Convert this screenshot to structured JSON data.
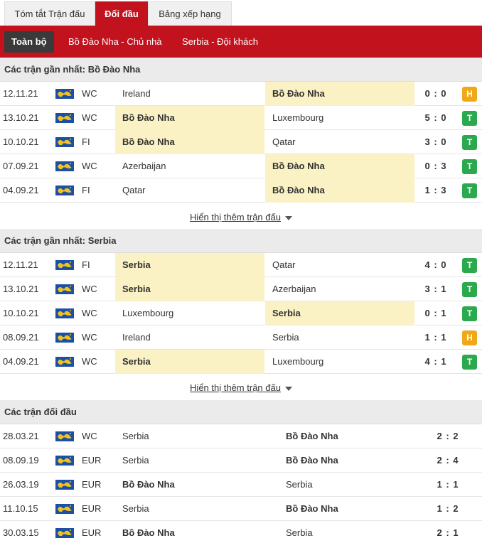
{
  "top_tabs": [
    "Tóm tắt Trận đấu",
    "Đối đầu",
    "Bảng xếp hạng"
  ],
  "sub_tabs": [
    "Toàn bộ",
    "Bồ Đào Nha - Chủ nhà",
    "Serbia - Đội khách"
  ],
  "colors": {
    "brand_red": "#c2121d",
    "win": "#2aa94d",
    "draw": "#f0a818",
    "highlight": "#faf2c4"
  },
  "section1": {
    "title": "Các trận gần nhất: Bồ Đào Nha",
    "rows": [
      {
        "date": "12.11.21",
        "comp": "WC",
        "home": "Ireland",
        "away": "Bồ Đào Nha",
        "score": "0 : 0",
        "result": "H"
      },
      {
        "date": "13.10.21",
        "comp": "WC",
        "home": "Bồ Đào Nha",
        "away": "Luxembourg",
        "score": "5 : 0",
        "result": "T"
      },
      {
        "date": "10.10.21",
        "comp": "FI",
        "home": "Bồ Đào Nha",
        "away": "Qatar",
        "score": "3 : 0",
        "result": "T"
      },
      {
        "date": "07.09.21",
        "comp": "WC",
        "home": "Azerbaijan",
        "away": "Bồ Đào Nha",
        "score": "0 : 3",
        "result": "T"
      },
      {
        "date": "04.09.21",
        "comp": "FI",
        "home": "Qatar",
        "away": "Bồ Đào Nha",
        "score": "1 : 3",
        "result": "T"
      }
    ],
    "more": "Hiển thị thêm trận đấu"
  },
  "section2": {
    "title": "Các trận gần nhất: Serbia",
    "rows": [
      {
        "date": "12.11.21",
        "comp": "FI",
        "home": "Serbia",
        "away": "Qatar",
        "score": "4 : 0",
        "result": "T"
      },
      {
        "date": "13.10.21",
        "comp": "WC",
        "home": "Serbia",
        "away": "Azerbaijan",
        "score": "3 : 1",
        "result": "T"
      },
      {
        "date": "10.10.21",
        "comp": "WC",
        "home": "Luxembourg",
        "away": "Serbia",
        "score": "0 : 1",
        "result": "T"
      },
      {
        "date": "08.09.21",
        "comp": "WC",
        "home": "Ireland",
        "away": "Serbia",
        "score": "1 : 1",
        "result": "H"
      },
      {
        "date": "04.09.21",
        "comp": "WC",
        "home": "Serbia",
        "away": "Luxembourg",
        "score": "4 : 1",
        "result": "T"
      }
    ],
    "more": "Hiển thị thêm trận đấu"
  },
  "section3": {
    "title": "Các trận đối đầu",
    "rows": [
      {
        "date": "28.03.21",
        "comp": "WC",
        "home": "Serbia",
        "away": "Bồ Đào Nha",
        "score": "2 : 2"
      },
      {
        "date": "08.09.19",
        "comp": "EUR",
        "home": "Serbia",
        "away": "Bồ Đào Nha",
        "score": "2 : 4"
      },
      {
        "date": "26.03.19",
        "comp": "EUR",
        "home": "Bồ Đào Nha",
        "away": "Serbia",
        "score": "1 : 1"
      },
      {
        "date": "11.10.15",
        "comp": "EUR",
        "home": "Serbia",
        "away": "Bồ Đào Nha",
        "score": "1 : 2"
      },
      {
        "date": "30.03.15",
        "comp": "EUR",
        "home": "Bồ Đào Nha",
        "away": "Serbia",
        "score": "2 : 1"
      }
    ]
  }
}
